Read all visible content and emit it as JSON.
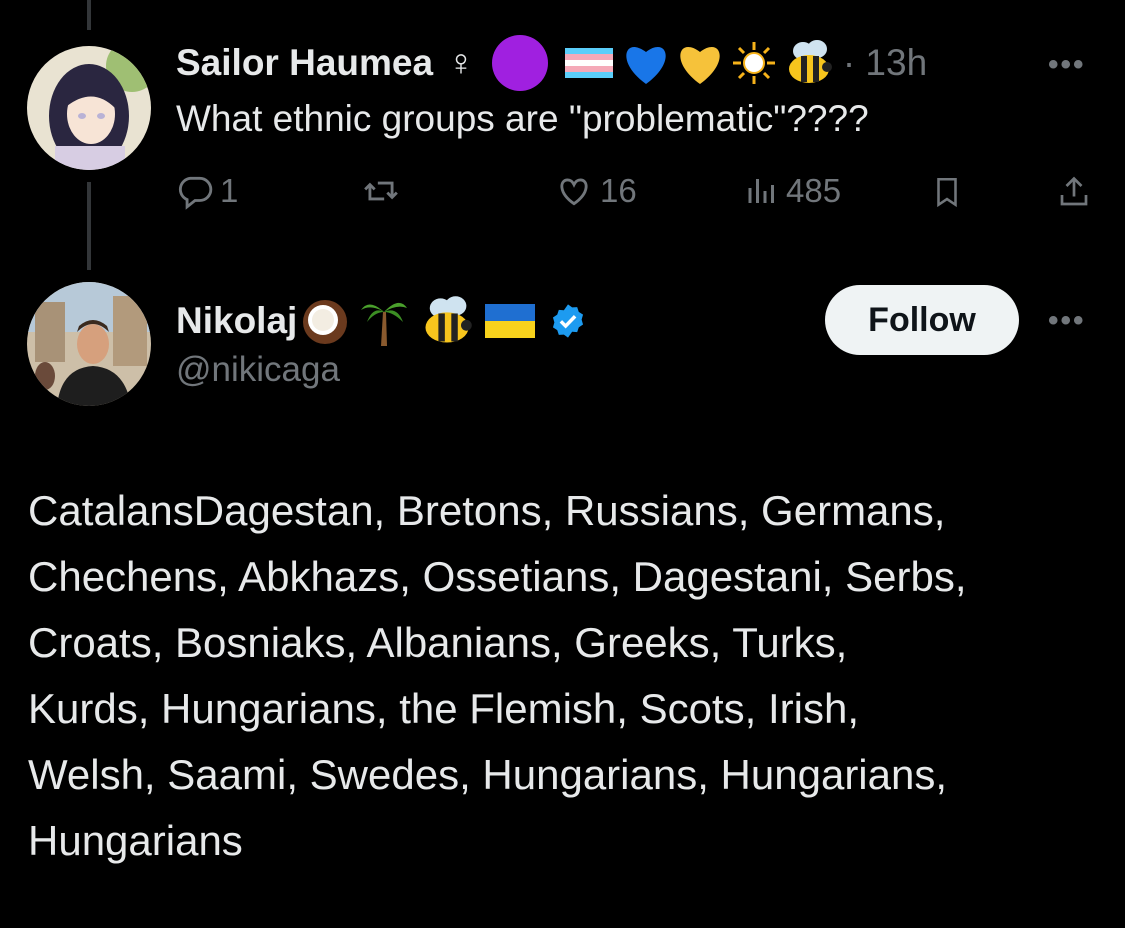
{
  "reply_parent": {
    "display_name": "Sailor Haumea",
    "name_symbols": "♀",
    "time": "· 13h",
    "text": "What ethnic groups are \"problematic\"????",
    "replies": "1",
    "likes": "16",
    "views": "485",
    "name_emoji_icons": [
      "purple-circle-icon",
      "trans-flag-icon",
      "blue-heart-icon",
      "yellow-heart-icon",
      "sun-icon",
      "bee-icon"
    ]
  },
  "tweet": {
    "display_name": "Nikolaj",
    "handle": "@nikicaga",
    "follow_label": "Follow",
    "name_emoji_icons": [
      "coconut-icon",
      "palm-tree-icon",
      "bee-icon",
      "ukraine-flag-icon",
      "verified-badge-icon"
    ],
    "verified_color": "#1d9bf0",
    "text_lines": [
      "CatalansDagestan, Bretons, Russians, Germans,",
      "Chechens, Abkhazs, Ossetians, Dagestani, Serbs,",
      "Croats, Bosniaks, Albanians, Greeks, Turks,",
      "Kurds, Hungarians, the Flemish, Scots, Irish,",
      "Welsh, Saami, Swedes, Hungarians, Hungarians,",
      "Hungarians"
    ]
  },
  "more_label": "•••"
}
